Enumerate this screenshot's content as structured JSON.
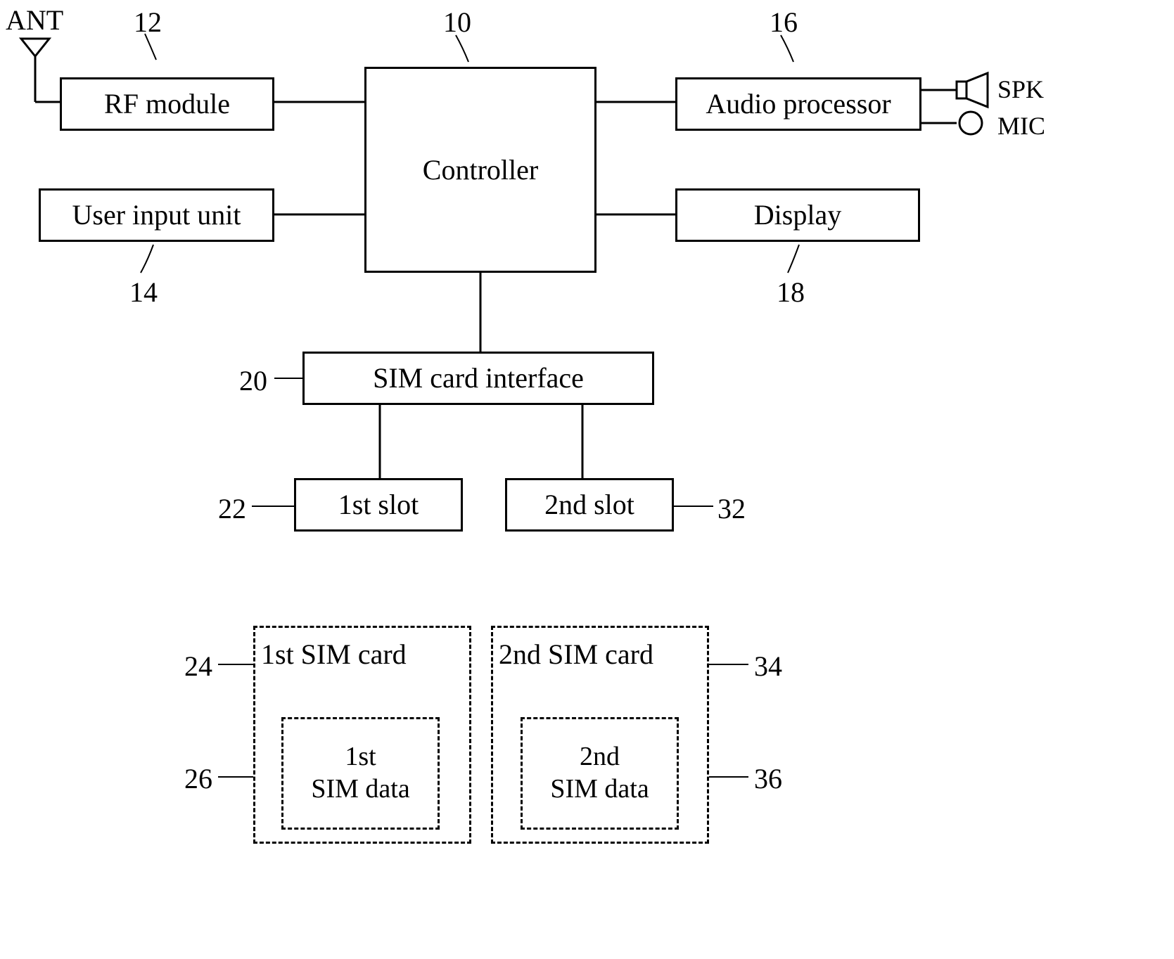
{
  "labels": {
    "ant": "ANT",
    "spk": "SPK",
    "mic": "MIC"
  },
  "refs": {
    "rf_module": "12",
    "controller": "10",
    "audio_processor": "16",
    "user_input_unit": "14",
    "display": "18",
    "sim_card_interface": "20",
    "first_slot": "22",
    "second_slot": "32",
    "first_sim_card": "24",
    "first_sim_data": "26",
    "second_sim_card": "34",
    "second_sim_data": "36"
  },
  "blocks": {
    "rf_module": "RF module",
    "controller": "Controller",
    "audio_processor": "Audio processor",
    "user_input_unit": "User input unit",
    "display": "Display",
    "sim_card_interface": "SIM card interface",
    "first_slot": "1st slot",
    "second_slot": "2nd slot",
    "first_sim_card": "1st SIM card",
    "first_sim_data": "1st\nSIM data",
    "second_sim_card": "2nd SIM card",
    "second_sim_data": "2nd\nSIM data"
  }
}
